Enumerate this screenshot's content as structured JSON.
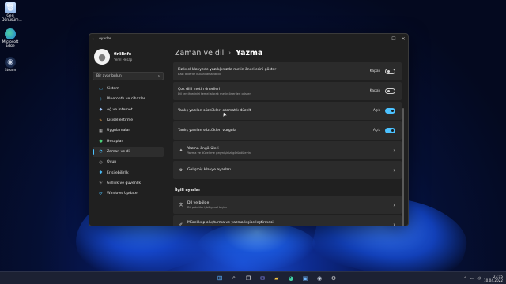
{
  "desktop": {
    "icons": [
      {
        "label": "Geri Dönüşüm...",
        "icon": "recycle-bin-icon"
      },
      {
        "label": "Microsoft Edge",
        "icon": "edge-icon"
      },
      {
        "label": "Steam",
        "icon": "steam-icon"
      }
    ]
  },
  "window": {
    "title": "Ayarlar",
    "controls": {
      "minimize": "–",
      "maximize": "☐",
      "close": "✕"
    }
  },
  "sidebar": {
    "profile": {
      "name": "firlilinfo",
      "subtitle": "Yerel Hesap"
    },
    "search": {
      "placeholder": "Bir ayar bulun"
    },
    "items": [
      {
        "label": "Sistem",
        "icon": "monitor-icon",
        "glyph": "▭",
        "color": "#4cc2ff",
        "active": false
      },
      {
        "label": "Bluetooth ve cihazlar",
        "icon": "bluetooth-icon",
        "glyph": "ᛒ",
        "color": "#4cc2ff",
        "active": false
      },
      {
        "label": "Ağ ve internet",
        "icon": "network-icon",
        "glyph": "◆",
        "color": "#9ec5ff",
        "active": false
      },
      {
        "label": "Kişiselleştirme",
        "icon": "brush-icon",
        "glyph": "✎",
        "color": "#e8a24c",
        "active": false
      },
      {
        "label": "Uygulamalar",
        "icon": "apps-icon",
        "glyph": "▦",
        "color": "#bdbdbd",
        "active": false
      },
      {
        "label": "Hesaplar",
        "icon": "person-icon",
        "glyph": "●",
        "color": "#4cd07a",
        "active": false
      },
      {
        "label": "Zaman ve dil",
        "icon": "globe-clock-icon",
        "glyph": "◔",
        "color": "#4cc2ff",
        "active": true
      },
      {
        "label": "Oyun",
        "icon": "gamepad-icon",
        "glyph": "◎",
        "color": "#bdbdbd",
        "active": false
      },
      {
        "label": "Erişilebilirlik",
        "icon": "accessibility-icon",
        "glyph": "✱",
        "color": "#4cc2ff",
        "active": false
      },
      {
        "label": "Gizlilik ve güvenlik",
        "icon": "shield-icon",
        "glyph": "⛨",
        "color": "#9a9a9a",
        "active": false
      },
      {
        "label": "Windows Update",
        "icon": "update-icon",
        "glyph": "⟳",
        "color": "#4cc2ff",
        "active": false
      }
    ]
  },
  "main": {
    "breadcrumb": {
      "parent": "Zaman ve dil",
      "separator": "›",
      "current": "Yazma"
    },
    "rows": [
      {
        "title": "Fiziksel klavyede yazdığınızda metin önerilerini göster",
        "desc": "Bazı dillerde kullanılamayabilir",
        "state": "Kapalı",
        "on": false,
        "icon": "",
        "chevron": false
      },
      {
        "title": "Çok dilli metin önerileri",
        "desc": "Dil tercihlerinizi temel alarak metin önerileri göster",
        "state": "Kapalı",
        "on": false,
        "icon": "",
        "chevron": false
      },
      {
        "title": "Yanlış yazılan sözcükleri otomatik düzelt",
        "desc": "",
        "state": "Açık",
        "on": true,
        "icon": "",
        "chevron": false
      },
      {
        "title": "Yanlış yazılan sözcükleri vurgula",
        "desc": "",
        "state": "Açık",
        "on": true,
        "icon": "",
        "chevron": false
      },
      {
        "title": "Yazma öngörüleri",
        "desc": "Yazma ve düzeltme geçmişinizi görüntüleyin",
        "state": "",
        "on": null,
        "icon": "lightbulb-icon",
        "chevron": true
      },
      {
        "title": "Gelişmiş klavye ayarları",
        "desc": "",
        "state": "",
        "on": null,
        "icon": "gear-icon",
        "chevron": true
      }
    ],
    "related_label": "İlgili ayarlar",
    "related": [
      {
        "title": "Dil ve bölge",
        "desc": "Dil paketleri, bölgesel biçim",
        "icon": "language-icon"
      },
      {
        "title": "Mürekkep oluşturma ve yazma kişiselleştirmesi",
        "desc": "Kişisel sözlük",
        "icon": "ink-icon"
      }
    ]
  },
  "taskbar": {
    "icons": [
      "start-icon",
      "search-icon",
      "task-view-icon",
      "chat-icon",
      "file-explorer-icon",
      "edge-icon",
      "store-icon",
      "steam-icon",
      "settings-icon"
    ],
    "tray": {
      "chevron": "^",
      "time": "23:15",
      "date": "10.04.2022"
    }
  }
}
